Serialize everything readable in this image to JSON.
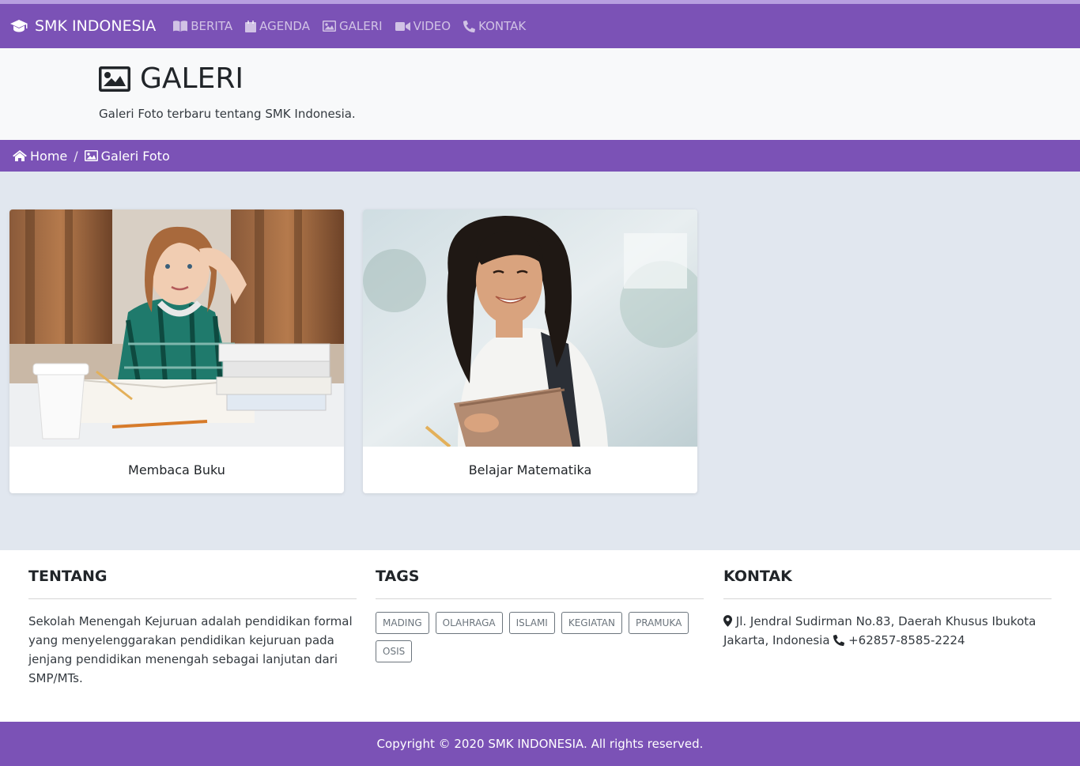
{
  "navbar": {
    "brand": "SMK INDONESIA",
    "items": [
      {
        "label": "BERITA",
        "icon": "book-icon"
      },
      {
        "label": "AGENDA",
        "icon": "calendar-icon"
      },
      {
        "label": "GALERI",
        "icon": "image-icon"
      },
      {
        "label": "VIDEO",
        "icon": "video-icon"
      },
      {
        "label": "KONTAK",
        "icon": "phone-icon"
      }
    ]
  },
  "header": {
    "title": "GALERI",
    "subtitle": "Galeri Foto terbaru tentang SMK Indonesia."
  },
  "breadcrumb": {
    "home": "Home",
    "separator": "/",
    "current": "Galeri Foto"
  },
  "gallery": {
    "cards": [
      {
        "caption": "Membaca Buku"
      },
      {
        "caption": "Belajar Matematika"
      }
    ]
  },
  "footer": {
    "about": {
      "title": "TENTANG",
      "text": "Sekolah Menengah Kejuruan adalah pendidikan formal yang menyelenggarakan pendidikan kejuruan pada jenjang pendidikan menengah sebagai lanjutan dari SMP/MTs."
    },
    "tags": {
      "title": "TAGS",
      "items": [
        "MADING",
        "OLAHRAGA",
        "ISLAMI",
        "KEGIATAN",
        "PRAMUKA",
        "OSIS"
      ]
    },
    "contact": {
      "title": "KONTAK",
      "address": "Jl. Jendral Sudirman No.83, Daerah Khusus Ibukota Jakarta, Indonesia",
      "phone": "+62857-8585-2224"
    }
  },
  "copyright": "Copyright © 2020 SMK INDONESIA. All rights reserved.",
  "colors": {
    "brand": "#7b52b6",
    "gallery_bg": "#e1e7ef",
    "jumbotron_bg": "#f8f9fa"
  }
}
